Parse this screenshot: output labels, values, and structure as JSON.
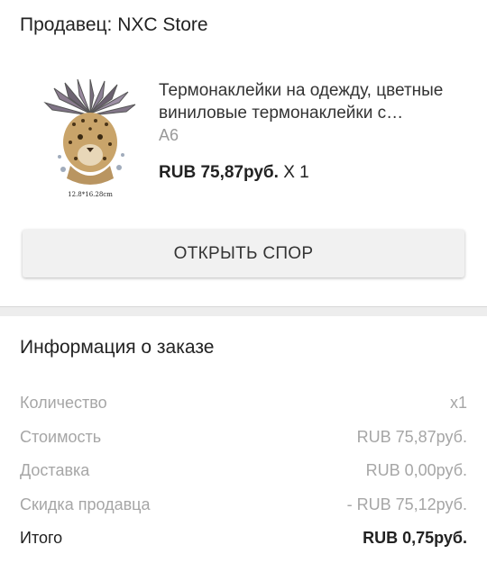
{
  "seller": {
    "label": "Продавец: NXC Store"
  },
  "product": {
    "title": "Термонаклейки на одежду, цветные виниловые термонаклейки с изображением леопарда",
    "variant": "A6",
    "price": "RUB 75,87руб.",
    "quantity": " X 1",
    "image_caption": "12.8*16.28cm"
  },
  "actions": {
    "open_dispute": "ОТКРЫТЬ СПОР"
  },
  "order_info": {
    "title": "Информация о заказе",
    "rows": [
      {
        "label": "Количество",
        "value": "x1"
      },
      {
        "label": "Стоимость",
        "value": "RUB 75,87руб."
      },
      {
        "label": "Доставка",
        "value": "RUB 0,00руб."
      },
      {
        "label": "Скидка продавца",
        "value": "- RUB 75,12руб."
      },
      {
        "label": "Итого",
        "value": "RUB 0,75руб."
      }
    ]
  }
}
